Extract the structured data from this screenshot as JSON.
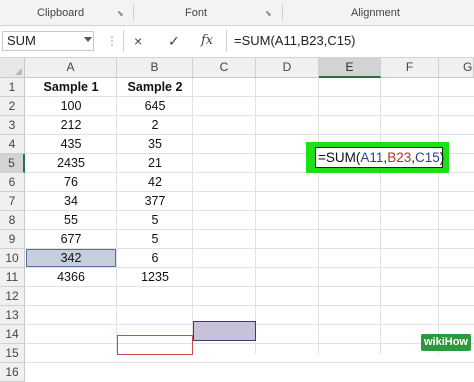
{
  "ribbon": {
    "groups": [
      {
        "label": "Clipboard",
        "launcher": "dialog-launcher-icon"
      },
      {
        "label": "Font",
        "launcher": "dialog-launcher-icon"
      },
      {
        "label": "Alignment",
        "launcher": "dialog-launcher-icon"
      }
    ]
  },
  "formula_bar": {
    "name_box": "SUM",
    "cancel_icon": "×",
    "enter_icon": "✓",
    "function_icon": "fx",
    "formula": "=SUM(A11,B23,C15)"
  },
  "columns": [
    "A",
    "B",
    "C",
    "D",
    "E",
    "F",
    "G"
  ],
  "selected_column": "E",
  "rows": [
    "1",
    "2",
    "3",
    "4",
    "5",
    "6",
    "7",
    "8",
    "9",
    "10",
    "11",
    "12",
    "13",
    "14",
    "15",
    "16"
  ],
  "selected_row": "5",
  "cells": {
    "A1": "Sample 1",
    "B1": "Sample 2",
    "A2": "100",
    "B2": "645",
    "A3": "212",
    "B3": "2",
    "A4": "435",
    "B4": "35",
    "A5": "2435",
    "B5": "21",
    "A6": "76",
    "B6": "42",
    "A7": "34",
    "B7": "377",
    "A8": "55",
    "B8": "5",
    "A9": "677",
    "B9": "5",
    "A10": "342",
    "B10": "6",
    "A11": "4366",
    "B11": "1235"
  },
  "edit_cell": {
    "prefix": "=SUM(",
    "ref1": "A11",
    "comma1": ",",
    "ref2": "B23",
    "comma2": ",",
    "ref3": "C15",
    "suffix": ")"
  },
  "colors": {
    "highlight_green": "#1ee01a",
    "ref_blue": "#2a3f95",
    "ref_red": "#c42b2b",
    "ref_purple": "#3e3a6a",
    "excel_green": "#217346"
  },
  "watermark": "wikiHow"
}
